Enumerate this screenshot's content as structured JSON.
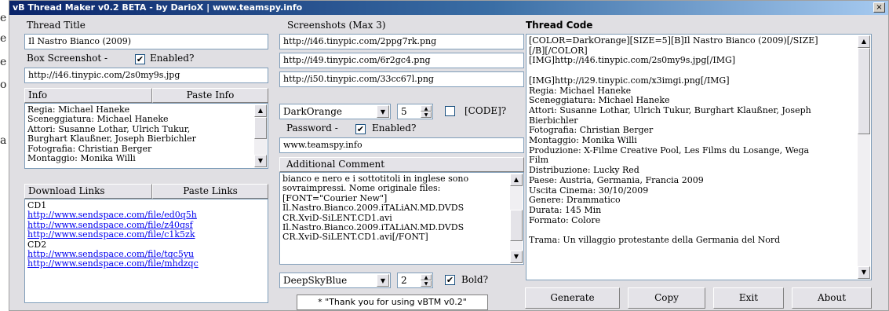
{
  "edge_text": [
    "e",
    "e",
    "e",
    "o",
    "a"
  ],
  "window": {
    "title": "vB Thread Maker v0.2 BETA - by DarioX | www.teamspy.info",
    "close_label": "×"
  },
  "left": {
    "thread_title_label": "Thread Title",
    "thread_title_value": "Il Nastro Bianco (2009)",
    "box_screenshot_label": "Box Screenshot  -",
    "box_enabled_label": "Enabled?",
    "box_enabled_checked": "✔",
    "box_url": "http://i46.tinypic.com/2s0my9s.jpg",
    "info_label": "Info",
    "paste_info_label": "Paste Info",
    "info_lines": [
      "Regia: Michael Haneke",
      "Sceneggiatura: Michael Haneke",
      "Attori: Susanne Lothar, Ulrich Tukur,",
      "Burghart Klaußner, Joseph Bierbichler",
      "Fotografia: Christian Berger",
      "Montaggio: Monika Willi"
    ],
    "download_links_label": "Download Links",
    "paste_links_label": "Paste Links",
    "links": [
      {
        "text": "CD1",
        "link": false
      },
      {
        "text": "http://www.sendspace.com/file/ed0q5h",
        "link": true
      },
      {
        "text": "http://www.sendspace.com/file/z40qsf",
        "link": true
      },
      {
        "text": "http://www.sendspace.com/file/c1k5zk",
        "link": true
      },
      {
        "text": "CD2",
        "link": false
      },
      {
        "text": "http://www.sendspace.com/file/tqc5yu",
        "link": true
      },
      {
        "text": "http://www.sendspace.com/file/mhdzqc",
        "link": true
      }
    ]
  },
  "middle": {
    "screenshots_label": "Screenshots (Max 3)",
    "screenshots": [
      "http://i46.tinypic.com/2ppg7rk.png",
      "http://i49.tinypic.com/6r2gc4.png",
      "http://i50.tinypic.com/33cc67l.png"
    ],
    "color_select": "DarkOrange",
    "size_value": "5",
    "code_label": "[CODE]?",
    "password_label": "Password  -",
    "password_enabled_label": "Enabled?",
    "password_enabled_checked": "✔",
    "password_value": "www.teamspy.info",
    "additional_comment_label": "Additional Comment",
    "comment_lines": [
      "bianco e nero e i sottotitoli in inglese sono",
      "sovraimpressi. Nome originale files:",
      "[FONT=\"Courier New\"]",
      "Il.Nastro.Bianco.2009.iTALiAN.MD.DVDS",
      "CR.XviD-SiLENT.CD1.avi",
      "Il.Nastro.Bianco.2009.iTALiAN.MD.DVDS",
      "CR.XviD-SiLENT.CD1.avi[/FONT]"
    ],
    "color2_select": "DeepSkyBlue",
    "size2_value": "2",
    "bold_label": "Bold?",
    "bold_checked": "✔",
    "status_text": "* \"Thank you for using vBTM v0.2\""
  },
  "right": {
    "thread_code_label": "Thread Code",
    "code_lines": [
      "[COLOR=DarkOrange][SIZE=5][B]Il Nastro Bianco (2009)[/SIZE]",
      "[/B][/COLOR]",
      "[IMG]http://i46.tinypic.com/2s0my9s.jpg[/IMG]",
      "",
      "[IMG]http://i29.tinypic.com/x3imgi.png[/IMG]",
      "Regia: Michael Haneke",
      "Sceneggiatura: Michael Haneke",
      "Attori: Susanne Lothar, Ulrich Tukur, Burghart Klaußner, Joseph",
      "Bierbichler",
      "Fotografia: Christian Berger",
      "Montaggio: Monika Willi",
      "Produzione: X-Filme Creative Pool, Les Films du Losange, Wega",
      "Film",
      "Distribuzione: Lucky Red",
      "Paese: Austria, Germania, Francia 2009",
      "Uscita Cinema: 30/10/2009",
      "Genere: Drammatico",
      "Durata: 145 Min",
      "Formato: Colore",
      "",
      "Trama: Un villaggio protestante della Germania del Nord"
    ],
    "buttons": {
      "generate": "Generate",
      "copy": "Copy",
      "exit": "Exit",
      "about": "About"
    }
  }
}
